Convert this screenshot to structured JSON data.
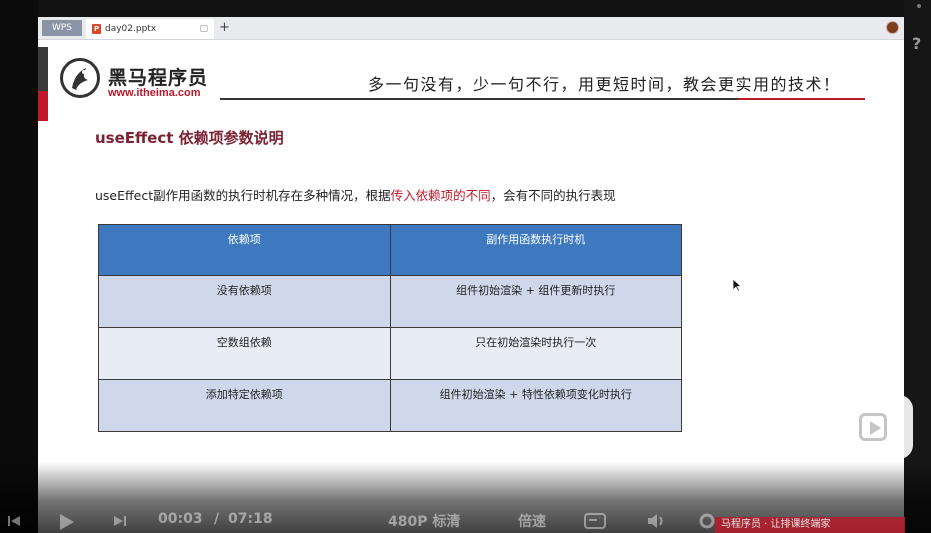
{
  "window": {
    "app_tab": "WPS",
    "file_tab": "day02.pptx",
    "file_tab_close": "▢",
    "new_tab": "+"
  },
  "slide": {
    "brand_name": "黑马程序员",
    "brand_url": "www.itheima.com",
    "slogan": "多一句没有，少一句不行，用更短时间，教会更实用的技术！",
    "heading": "useEffect 依赖项参数说明",
    "desc_before": "useEffect副作用函数的执行时机存在多种情况，根据",
    "desc_highlight": "传入依赖项的不同",
    "desc_after": "，会有不同的执行表现",
    "table": {
      "headers": [
        "依赖项",
        "副作用函数执行时机"
      ],
      "rows": [
        [
          "没有依赖项",
          "组件初始渲染 + 组件更新时执行"
        ],
        [
          "空数组依赖",
          "只在初始渲染时执行一次"
        ],
        [
          "添加特定依赖项",
          "组件初始渲染 + 特性依赖项变化时执行"
        ]
      ]
    }
  },
  "player": {
    "time_current": "00:03",
    "time_separator": "/",
    "time_total": "07:18",
    "quality": "480P 标清",
    "speed": "倍速",
    "badge": "马程序员 · 让排课终端家"
  },
  "colors": {
    "brand_red": "#c0182b",
    "heading": "#7b2233",
    "table_header": "#3e79c0",
    "row_dark": "#cfd8ea",
    "row_light": "#e8ecf5"
  }
}
